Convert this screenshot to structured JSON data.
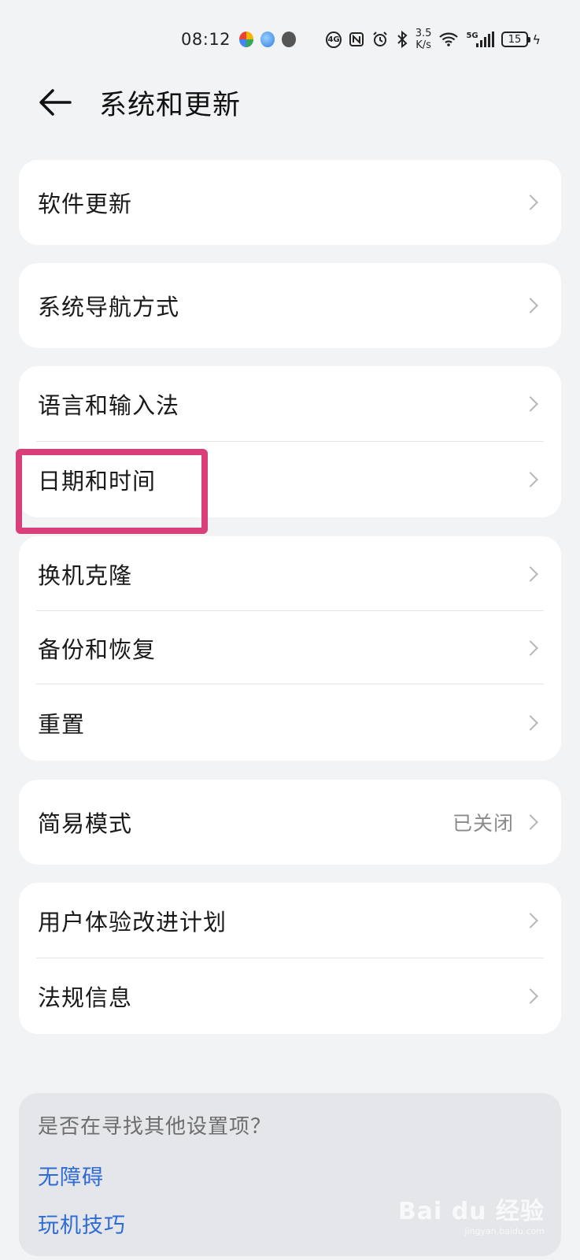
{
  "status_bar": {
    "time": "08:12",
    "speed_value": "3.5",
    "speed_unit": "K/s",
    "network": "5G",
    "battery": "15"
  },
  "header": {
    "title": "系统和更新"
  },
  "groups": [
    {
      "items": [
        {
          "label": "软件更新"
        }
      ]
    },
    {
      "items": [
        {
          "label": "系统导航方式"
        }
      ]
    },
    {
      "items": [
        {
          "label": "语言和输入法"
        },
        {
          "label": "日期和时间"
        }
      ]
    },
    {
      "items": [
        {
          "label": "换机克隆"
        },
        {
          "label": "备份和恢复"
        },
        {
          "label": "重置"
        }
      ]
    },
    {
      "items": [
        {
          "label": "简易模式",
          "value": "已关闭"
        }
      ]
    },
    {
      "items": [
        {
          "label": "用户体验改进计划"
        },
        {
          "label": "法规信息"
        }
      ]
    }
  ],
  "suggestions": {
    "question": "是否在寻找其他设置项？",
    "links": [
      "无障碍",
      "玩机技巧"
    ]
  },
  "watermark": {
    "text": "Bai du 经验",
    "sub": "jingyan.baidu.com"
  },
  "colors": {
    "highlight": "#d9407a",
    "link": "#2f6bd6",
    "background": "#f1f3f5"
  }
}
